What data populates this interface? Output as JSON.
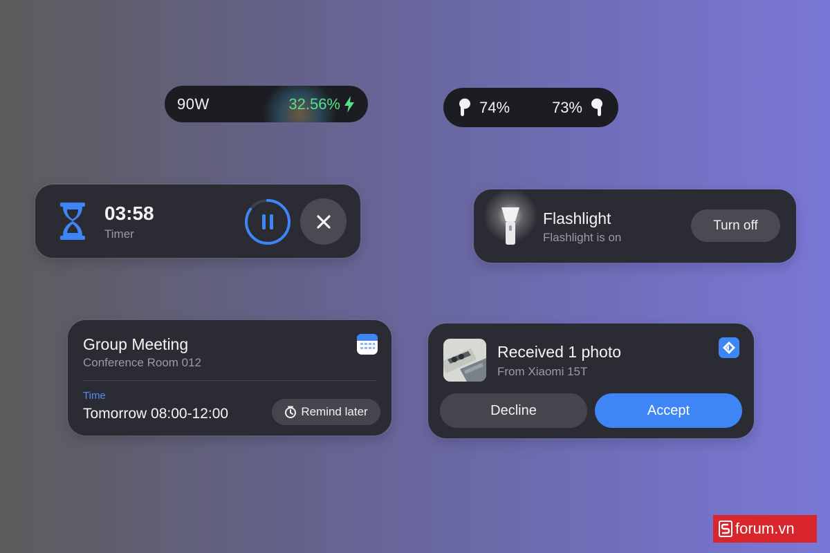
{
  "charging": {
    "wattage": "90W",
    "percent": "32.56%",
    "icon": "bolt-icon",
    "percent_color": "#55e08a"
  },
  "earbuds": {
    "left_percent": "74%",
    "right_percent": "73%",
    "icon": "earbud-icon"
  },
  "timer": {
    "time": "03:58",
    "label": "Timer",
    "progress": 0.85,
    "accent": "#3e86f6",
    "pause_icon": "pause-icon",
    "close_icon": "close-icon"
  },
  "flashlight": {
    "title": "Flashlight",
    "subtitle": "Flashlight is on",
    "button_label": "Turn off",
    "icon": "flashlight-icon"
  },
  "meeting": {
    "title": "Group Meeting",
    "location": "Conference Room 012",
    "time_label": "Time",
    "time_value": "Tomorrow 08:00-12:00",
    "remind_label": "Remind later",
    "icon": "calendar-icon"
  },
  "photo_share": {
    "title": "Received 1 photo",
    "subtitle": "From Xiaomi 15T",
    "decline_label": "Decline",
    "accept_label": "Accept",
    "accept_color": "#3e86f6",
    "icon": "share-app-icon"
  },
  "watermark": {
    "text": "forum.vn"
  }
}
